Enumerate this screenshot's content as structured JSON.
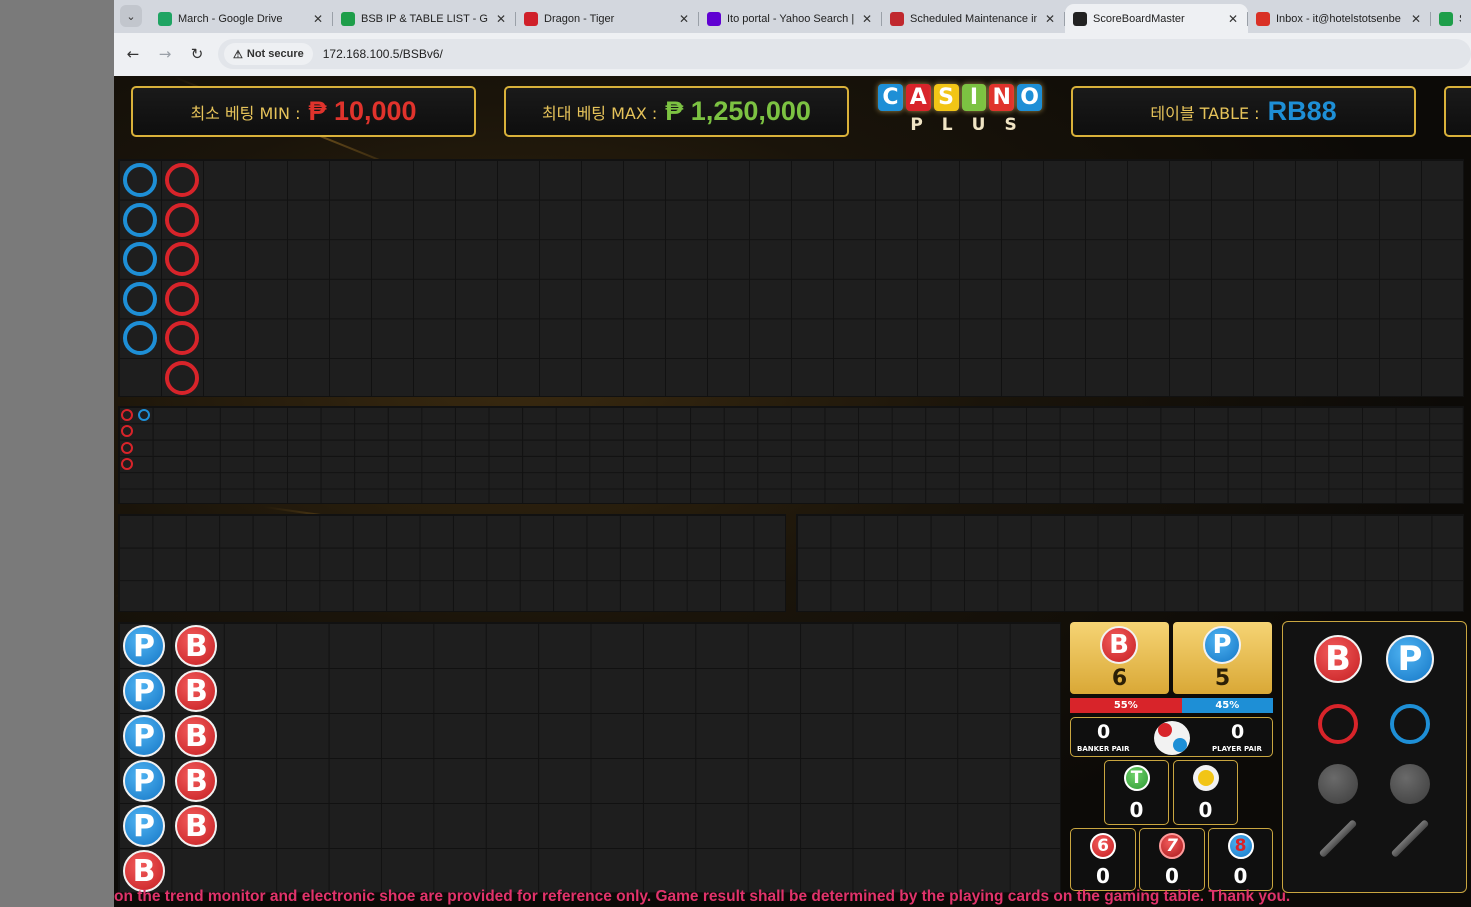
{
  "browser": {
    "tabs": [
      {
        "title": "March - Google Drive",
        "icon": "google-drive-icon",
        "color": "#1fa463"
      },
      {
        "title": "BSB IP & TABLE LIST - Goo",
        "icon": "sheets-icon",
        "color": "#1e9e4a"
      },
      {
        "title": "Dragon - Tiger",
        "icon": "dragon-tiger-icon",
        "color": "#d0202a"
      },
      {
        "title": "Ito portal - Yahoo Search |",
        "icon": "yahoo-icon",
        "color": "#6001d2"
      },
      {
        "title": "Scheduled Maintenance in",
        "icon": "maintenance-icon",
        "color": "#c0282e"
      },
      {
        "title": "ScoreBoardMaster",
        "icon": "scoreboard-icon",
        "color": "#222222"
      },
      {
        "title": "Inbox - it@hotelstotsenbe",
        "icon": "gmail-icon",
        "color": "#d93025"
      },
      {
        "title": "SY",
        "icon": "sheets-icon",
        "color": "#1e9e4a"
      }
    ],
    "active_tab": 5,
    "security_label": "Not secure",
    "url": "172.168.100.5/BSBv6/"
  },
  "header": {
    "min_label": "최소 베팅 MIN :",
    "min_value": "₱ 10,000",
    "max_label": "최대 베팅 MAX :",
    "max_value": "₱ 1,250,000",
    "table_label": "테이블 TABLE :",
    "table_value": "RB88",
    "logo_top": [
      "C",
      "A",
      "S",
      "I",
      "N",
      "O"
    ],
    "logo_bottom": [
      "P",
      "L",
      "U",
      "S"
    ]
  },
  "colors": {
    "banker": "#d8242a",
    "player": "#1e8fd6",
    "gold": "#d9b13a",
    "min_value": "#e0332c",
    "max_value": "#7cc242",
    "table_value": "#1e8fd6"
  },
  "big_road": {
    "columns": [
      [
        "player",
        "player",
        "player",
        "player",
        "player"
      ],
      [
        "banker",
        "banker",
        "banker",
        "banker",
        "banker",
        "banker"
      ]
    ]
  },
  "small_road": {
    "columns": [
      [
        "banker",
        "banker",
        "banker",
        "banker"
      ],
      [
        "player"
      ]
    ]
  },
  "bead_plate": {
    "columns": [
      [
        "P",
        "P",
        "P",
        "P",
        "P",
        "B"
      ],
      [
        "B",
        "B",
        "B",
        "B",
        "B"
      ]
    ]
  },
  "stats": {
    "banker_label": "B",
    "banker_count": "6",
    "player_label": "P",
    "player_count": "5",
    "banker_pct": "55%",
    "player_pct": "45%",
    "banker_pct_value": 55,
    "player_pct_value": 45,
    "banker_pair_count": "0",
    "banker_pair_label": "BANKER PAIR",
    "player_pair_count": "0",
    "player_pair_label": "PLAYER PAIR",
    "tie_label": "T",
    "tie_count": "0",
    "natural_count": "0",
    "six_label": "6",
    "six_count": "0",
    "seven_label": "7",
    "seven_count": "0",
    "eight_label": "8",
    "eight_count": "0"
  },
  "legend": {
    "banker_label": "B",
    "player_label": "P"
  },
  "ticker": "on the trend monitor and electronic shoe are provided for reference only. Game result shall be determined by the playing cards on the gaming table. Thank you."
}
